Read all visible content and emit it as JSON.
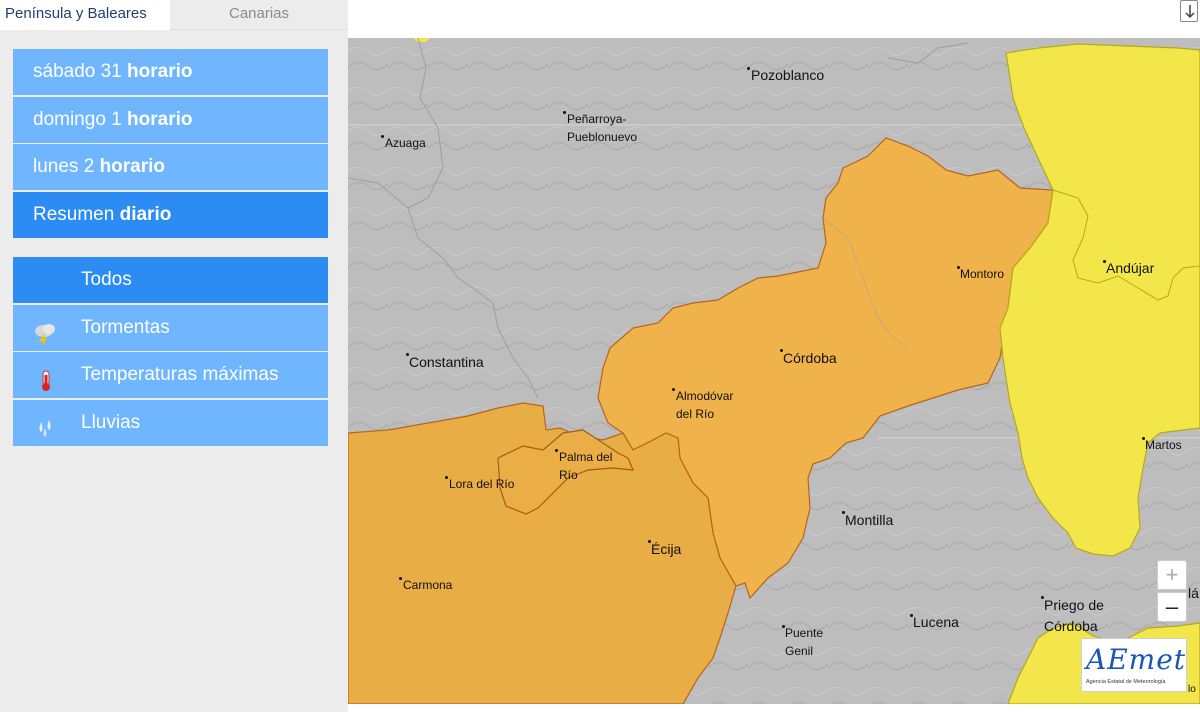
{
  "tabs": {
    "peninsula": "Península y Baleares",
    "canarias": "Canarias"
  },
  "days": [
    {
      "day": "sábado 31",
      "mode": "horario"
    },
    {
      "day": "domingo 1",
      "mode": "horario"
    },
    {
      "day": "lunes 2",
      "mode": "horario"
    },
    {
      "day": "Resumen",
      "mode": "diario"
    }
  ],
  "phenomena": [
    {
      "label": "Todos",
      "icon": "all-icon"
    },
    {
      "label": "Tormentas",
      "icon": "storm-icon"
    },
    {
      "label": "Temperaturas máximas",
      "icon": "thermometer-icon"
    },
    {
      "label": "Lluvias",
      "icon": "rain-icon"
    }
  ],
  "map": {
    "warning_colors": {
      "orange": "#f0b24a",
      "yellow": "#f2e64a",
      "none": "#bdbdbd"
    },
    "cities": {
      "pozoblanco": "Pozoblanco",
      "penarroya": "Peñarroya-",
      "penarroya2": "Pueblonuevo",
      "azuaga": "Azuaga",
      "montoro": "Montoro",
      "andujar": "Andújar",
      "constantina": "Constantina",
      "cordoba": "Córdoba",
      "almodovar": "Almodóvar",
      "almodovar2": "del Río",
      "palma": "Palma del",
      "palma2": "Río",
      "lora": "Lora del Río",
      "martos": "Martos",
      "montilla": "Montilla",
      "ecija": "Écija",
      "carmona": "Carmona",
      "puente": "Puente",
      "puente2": "Genil",
      "lucena": "Lucena",
      "priego": "Priego de",
      "priego2": "Córdoba",
      "edge_la": "lá",
      "edge_lo": "lo"
    },
    "zoom_in": "+",
    "zoom_out": "–",
    "logo": "AEmet",
    "logo_sub": "Agencia Estatal de Meteorología"
  }
}
